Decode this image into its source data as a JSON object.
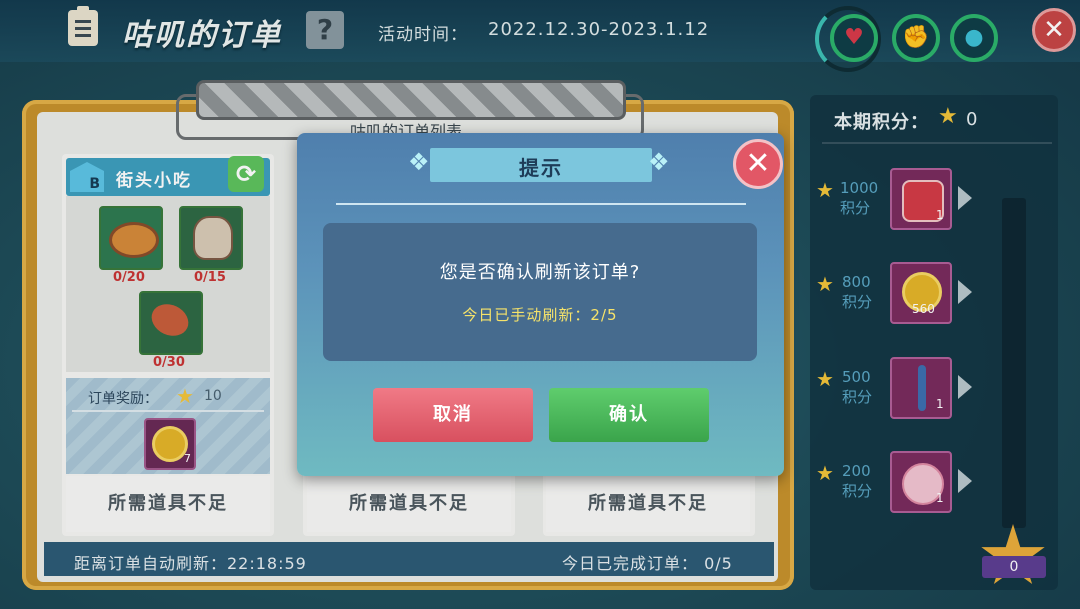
{
  "header": {
    "title": "咕叽的订单",
    "help_label": "?",
    "time_label": "活动时间：",
    "time_value": "2022.12.30-2023.1.12",
    "stats": [
      {
        "icon": "heart-icon",
        "glyph": "♥"
      },
      {
        "icon": "muscle-icon",
        "glyph": "✊"
      },
      {
        "icon": "water-drop-icon",
        "glyph": "●"
      }
    ],
    "close_glyph": "✕"
  },
  "board": {
    "list_label": "咕叽的订单列表",
    "order_card": {
      "badge": "B",
      "title": "街头小吃",
      "refresh_glyph": "⟳",
      "items": [
        {
          "icon": "pie-icon",
          "count": "0/20"
        },
        {
          "icon": "dumpling-icon",
          "count": "0/15"
        },
        {
          "icon": "drumstick-icon",
          "count": "0/30"
        }
      ],
      "reward_label": "订单奖励：",
      "reward_star": "★",
      "reward_value": "10",
      "reward_item_qty": "7"
    },
    "status": [
      "所需道具不足",
      "所需道具不足",
      "所需道具不足"
    ],
    "auto_refresh_label": "距离订单自动刷新：22:18:59",
    "completed_label": "今日已完成订单： 0/5"
  },
  "points_panel": {
    "title": "本期积分：",
    "star": "★",
    "score": "0",
    "tiers": [
      {
        "points": "1000",
        "unit": "积分",
        "qty": "1",
        "icon": "cake-icon"
      },
      {
        "points": "800",
        "unit": "积分",
        "qty": "560",
        "icon": "shell-coin-icon"
      },
      {
        "points": "500",
        "unit": "积分",
        "qty": "1",
        "icon": "staff-icon"
      },
      {
        "points": "200",
        "unit": "积分",
        "qty": "1",
        "icon": "flower-icon"
      }
    ],
    "big_star_value": "0"
  },
  "dialog": {
    "title": "提示",
    "close_glyph": "✕",
    "question": "您是否确认刷新该订单?",
    "info": "今日已手动刷新：2/5",
    "cancel_label": "取消",
    "confirm_label": "确认",
    "ornament_left": "❖",
    "ornament_right": "❖"
  },
  "colors": {
    "accent_green": "#3aa44b",
    "accent_red": "#d8505f",
    "info_yellow": "#f6e36a",
    "item_count_red": "#c93434",
    "board_gold": "#c7922d"
  }
}
